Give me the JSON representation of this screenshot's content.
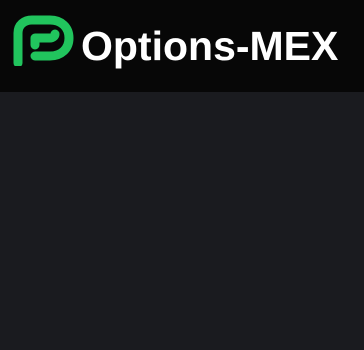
{
  "header": {
    "brand_name": "Options-MEX",
    "logo_icon": "p-logo-icon",
    "brand_color": "#21c45d"
  },
  "colors": {
    "header_background": "#070707",
    "page_background": "#1a1b1f",
    "text": "#ffffff"
  }
}
